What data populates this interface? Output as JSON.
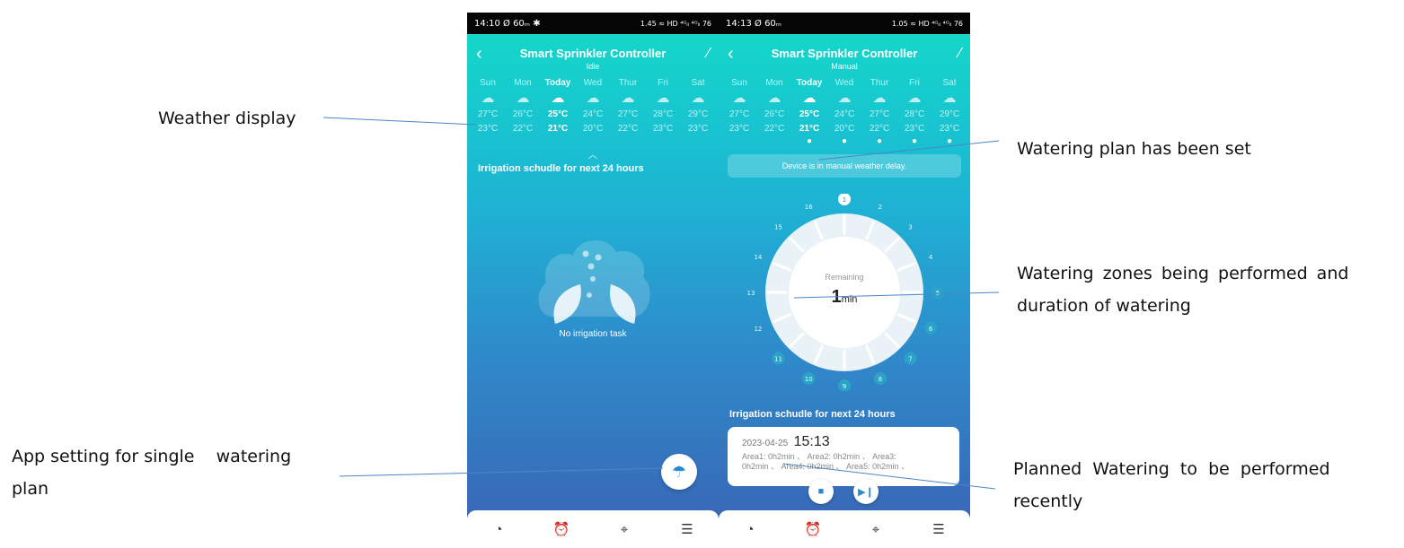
{
  "annotations": {
    "weather_display": "Weather display",
    "single_plan_line1": "App setting for single    watering",
    "single_plan_line2": "plan",
    "plan_set": "Watering plan has been set",
    "zones_line1": "Watering zones being performed and",
    "zones_line2": "duration of watering",
    "planned_line1": "Planned  Watering  to  be  performed",
    "planned_line2": "recently"
  },
  "left_phone": {
    "status_time": "14:10",
    "status_left_icons": "Ø 60ₘ ✱",
    "status_right": "1.45 ≈ HD ⁴ᴳₗₗ ⁴ᴳₗₗ 76",
    "title": "Smart Sprinkler Controller",
    "status": "Idle",
    "section_title": "Irrigation schudle for next 24 hours",
    "no_task": "No irrigation task"
  },
  "right_phone": {
    "status_time": "14:13",
    "status_left_icons": "Ø 60ₘ",
    "status_right": "1.05 ≈ HD ⁴ᴳₗₗ ⁴ᴳₗₗ 76",
    "title": "Smart Sprinkler Controller",
    "status": "Manual",
    "delay_banner": "Device is in manual weather delay.",
    "remaining_label": "Remaining",
    "remaining_value": "1",
    "remaining_unit": "min",
    "section_title": "Irrigation schudle for next 24 hours",
    "plan_date": "2023-04-25",
    "plan_time": "15:13",
    "plan_areas_line1": "Area1: 0h2min 、 Area2: 0h2min 、 Area3:",
    "plan_areas_line2": "0h2min 、 Area4: 0h2min 、 Area5: 0h2min 、",
    "zones": [
      "1",
      "2",
      "3",
      "4",
      "5",
      "6",
      "7",
      "8",
      "9",
      "10",
      "11",
      "12",
      "13",
      "14",
      "15",
      "16"
    ]
  },
  "weather": [
    {
      "day": "Sun",
      "hi": "27°C",
      "lo": "23°C",
      "today": false
    },
    {
      "day": "Mon",
      "hi": "26°C",
      "lo": "22°C",
      "today": false
    },
    {
      "day": "Today",
      "hi": "25°C",
      "lo": "21°C",
      "today": true
    },
    {
      "day": "Wed",
      "hi": "24°C",
      "lo": "20°C",
      "today": false
    },
    {
      "day": "Thur",
      "hi": "27°C",
      "lo": "22°C",
      "today": false
    },
    {
      "day": "Fri",
      "hi": "28°C",
      "lo": "23°C",
      "today": false
    },
    {
      "day": "Sat",
      "hi": "29°C",
      "lo": "23°C",
      "today": false
    }
  ],
  "icons": {
    "back": "‹",
    "edit": "∕",
    "weather": "☁",
    "drop": "●",
    "caret": "︿",
    "fab": "☂",
    "stop": "■",
    "skip": "▶❙",
    "nav": [
      "◔",
      "⏰",
      "⌖",
      "☰"
    ]
  },
  "colors": {
    "gradient_top": "#14dac6",
    "gradient_bottom": "#3a62b4",
    "accent": "#2a8ad0",
    "active_zone": "#ffffff"
  }
}
